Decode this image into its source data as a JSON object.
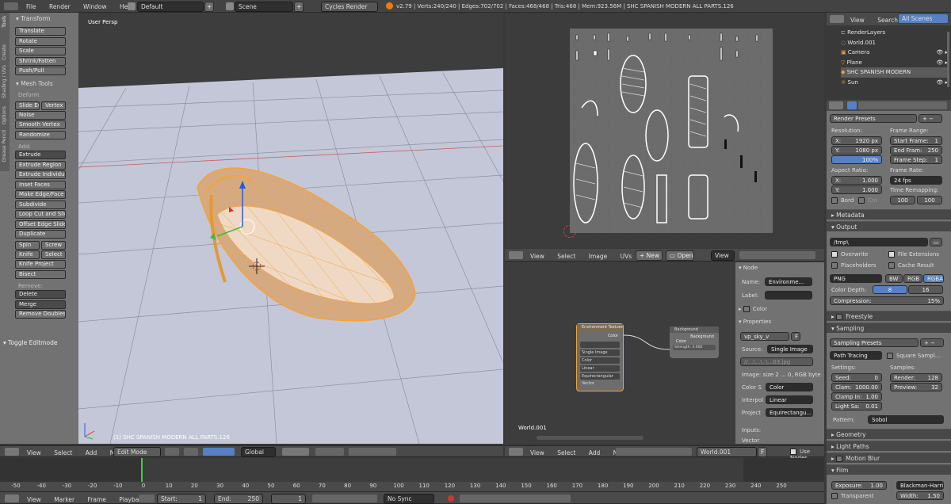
{
  "top": {
    "menus": [
      "File",
      "Render",
      "Window",
      "Help"
    ],
    "layout": "Default",
    "scene": "Scene",
    "engine": "Cycles Render",
    "stats": "v2.79 | Verts:240/240 | Edges:702/702 | Faces:468/468 | Tris:468 | Mem:923.56M | SHC SPANISH MODERN ALL PARTS.126"
  },
  "tools": {
    "tabs": [
      "Tools",
      "Create",
      "Shading / UVs",
      "Options",
      "Grease Pencil"
    ],
    "transform_header": "Transform",
    "transform": [
      "Translate",
      "Rotate",
      "Scale",
      "Shrink/Fatten",
      "Push/Pull"
    ],
    "mesh_header": "Mesh Tools",
    "deform_label": "Deform:",
    "deform_pair": [
      "Slide Ed",
      "Vertex"
    ],
    "deform": [
      "Noise",
      "Smooth Vertex",
      "Randomize"
    ],
    "add_label": "Add:",
    "extrude": "Extrude",
    "add": [
      "Extrude Region",
      "Extrude Individual",
      "Inset Faces",
      "Make Edge/Face",
      "Subdivide",
      "Loop Cut and Slide",
      "Offset Edge Slide",
      "Duplicate"
    ],
    "pair1": [
      "Spin",
      "Screw"
    ],
    "pair2": [
      "Knife",
      "Select"
    ],
    "add2": [
      "Knife Project",
      "Bisect"
    ],
    "remove_label": "Remove:",
    "remove": [
      "Delete",
      "Merge"
    ],
    "remove_doubles": "Remove Doubles",
    "toggle": "Toggle Editmode"
  },
  "viewport": {
    "label": "User Persp",
    "object": "(1) SHC SPANISH MODERN ALL PARTS.126",
    "menus": [
      "View",
      "Select",
      "Add",
      "Mesh"
    ],
    "mode": "Edit Mode",
    "orientation": "Global"
  },
  "timeline": {
    "ticks": [
      "-50",
      "-40",
      "-30",
      "-20",
      "-10",
      "0",
      "10",
      "20",
      "30",
      "40",
      "50",
      "60",
      "70",
      "80",
      "90",
      "100",
      "110",
      "120",
      "130",
      "140",
      "150",
      "160",
      "170",
      "180",
      "190",
      "200",
      "210",
      "220",
      "230",
      "240",
      "250"
    ],
    "menus": [
      "View",
      "Marker",
      "Frame",
      "Playback"
    ],
    "start": "Start:",
    "start_val": "1",
    "end": "End:",
    "end_val": "250",
    "current": "1",
    "sync": "No Sync"
  },
  "image_editor": {
    "menus": [
      "View",
      "Select",
      "Image",
      "UVs"
    ],
    "new": "New",
    "open": "Open",
    "view": "View"
  },
  "node_editor": {
    "node1": {
      "title": "Environment Texture",
      "rows": [
        "Color",
        "Single Image",
        "Color",
        "Linear",
        "Equirectangular"
      ],
      "extra": "Vector"
    },
    "node2": {
      "title": "Background",
      "out": "Background",
      "in": "Color",
      "strength": "Strength: 3.000"
    },
    "world": "World.001",
    "menus": [
      "View",
      "Select",
      "Add",
      "Node"
    ],
    "world_field": "World.001",
    "f": "F",
    "use_nodes": "Use Nodes"
  },
  "node_side": {
    "node_header": "Node",
    "name_label": "Name:",
    "name_val": "Environme...",
    "label_label": "Label:",
    "color": "Color",
    "properties": "Properties",
    "image": "vp_sky_v",
    "f": "F",
    "source_label": "Source:",
    "source_val": "Single Image",
    "path": "//...\\...\\..\\...03.jpg",
    "image_info": "Image: size 2 ... 0, RGB byte",
    "colors_label": "Color S",
    "colors_val": "Color",
    "interp_label": "Interpol",
    "interp_val": "Linear",
    "proj_label": "Project",
    "proj_val": "Equirectangu...",
    "inputs": "Inputs:",
    "vector": "Vector"
  },
  "outliner": {
    "menus": [
      "View",
      "Search"
    ],
    "filter": "All Scenes",
    "items": [
      "RenderLayers",
      "World.001",
      "Camera",
      "Plane",
      "SHC SPANISH MODERN",
      "Sun"
    ]
  },
  "props": {
    "render_presets": "Render Presets",
    "resolution": "Resolution:",
    "res_x": "X:",
    "res_x_val": "1920 px",
    "res_y": "Y:",
    "res_y_val": "1080 px",
    "res_pct": "100%",
    "frame_range": "Frame Range:",
    "start_frame": "Start Frame:",
    "start_frame_val": "1",
    "end_frame": "End Fram:",
    "end_frame_val": "250",
    "frame_step": "Frame Step:",
    "frame_step_val": "1",
    "aspect": "Aspect Ratio:",
    "asp_x": "X:",
    "asp_x_val": "1.000",
    "asp_y": "Y:",
    "asp_y_val": "1.000",
    "frame_rate": "Frame Rate:",
    "fps": "24 fps",
    "time_remap": "Time Remapping:",
    "remap_a": "100",
    "remap_b": "100",
    "bord": "Bord",
    "cro": "Cro",
    "metadata": "Metadata",
    "output": "Output",
    "path": "/tmp\\",
    "overwrite": "Overwrite",
    "file_ext": "File Extensions",
    "placeholders": "Placeholders",
    "cache_result": "Cache Result",
    "format": "PNG",
    "bw": "BW",
    "rgb": "RGB",
    "rgba": "RGBA",
    "color_depth": "Color Depth:",
    "depth8": "8",
    "depth16": "16",
    "compression": "Compression:",
    "compression_val": "15%",
    "freestyle": "Freestyle",
    "sampling": "Sampling",
    "sampling_presets": "Sampling Presets",
    "path_tracing": "Path Tracing",
    "square_samples": "Square Sampl...",
    "settings": "Settings:",
    "seed": "Seed:",
    "seed_val": "0",
    "clamp_direct": "Clam:",
    "clamp_direct_val": "1000.00",
    "clamp_indirect": "Clamp In:",
    "clamp_indirect_val": "1.00",
    "light_sample": "Light Sa:",
    "light_sample_val": "0.01",
    "samples": "Samples:",
    "render": "Render:",
    "render_val": "128",
    "preview": "Preview:",
    "preview_val": "32",
    "pattern": "Pattern:",
    "pattern_val": "Sobol",
    "geometry": "Geometry",
    "light_paths": "Light Paths",
    "motion_blur": "Motion Blur",
    "film": "Film",
    "exposure": "Exposure:",
    "exposure_val": "1.00",
    "filter": "Blackman-Harris",
    "transparent": "Transparent",
    "width": "Width:",
    "width_val": "1.50"
  },
  "colors": {
    "accent": "#5680c2",
    "viewport_bg": "#c3c6d8",
    "selected": "#f3a33a",
    "panel": "#727272"
  }
}
